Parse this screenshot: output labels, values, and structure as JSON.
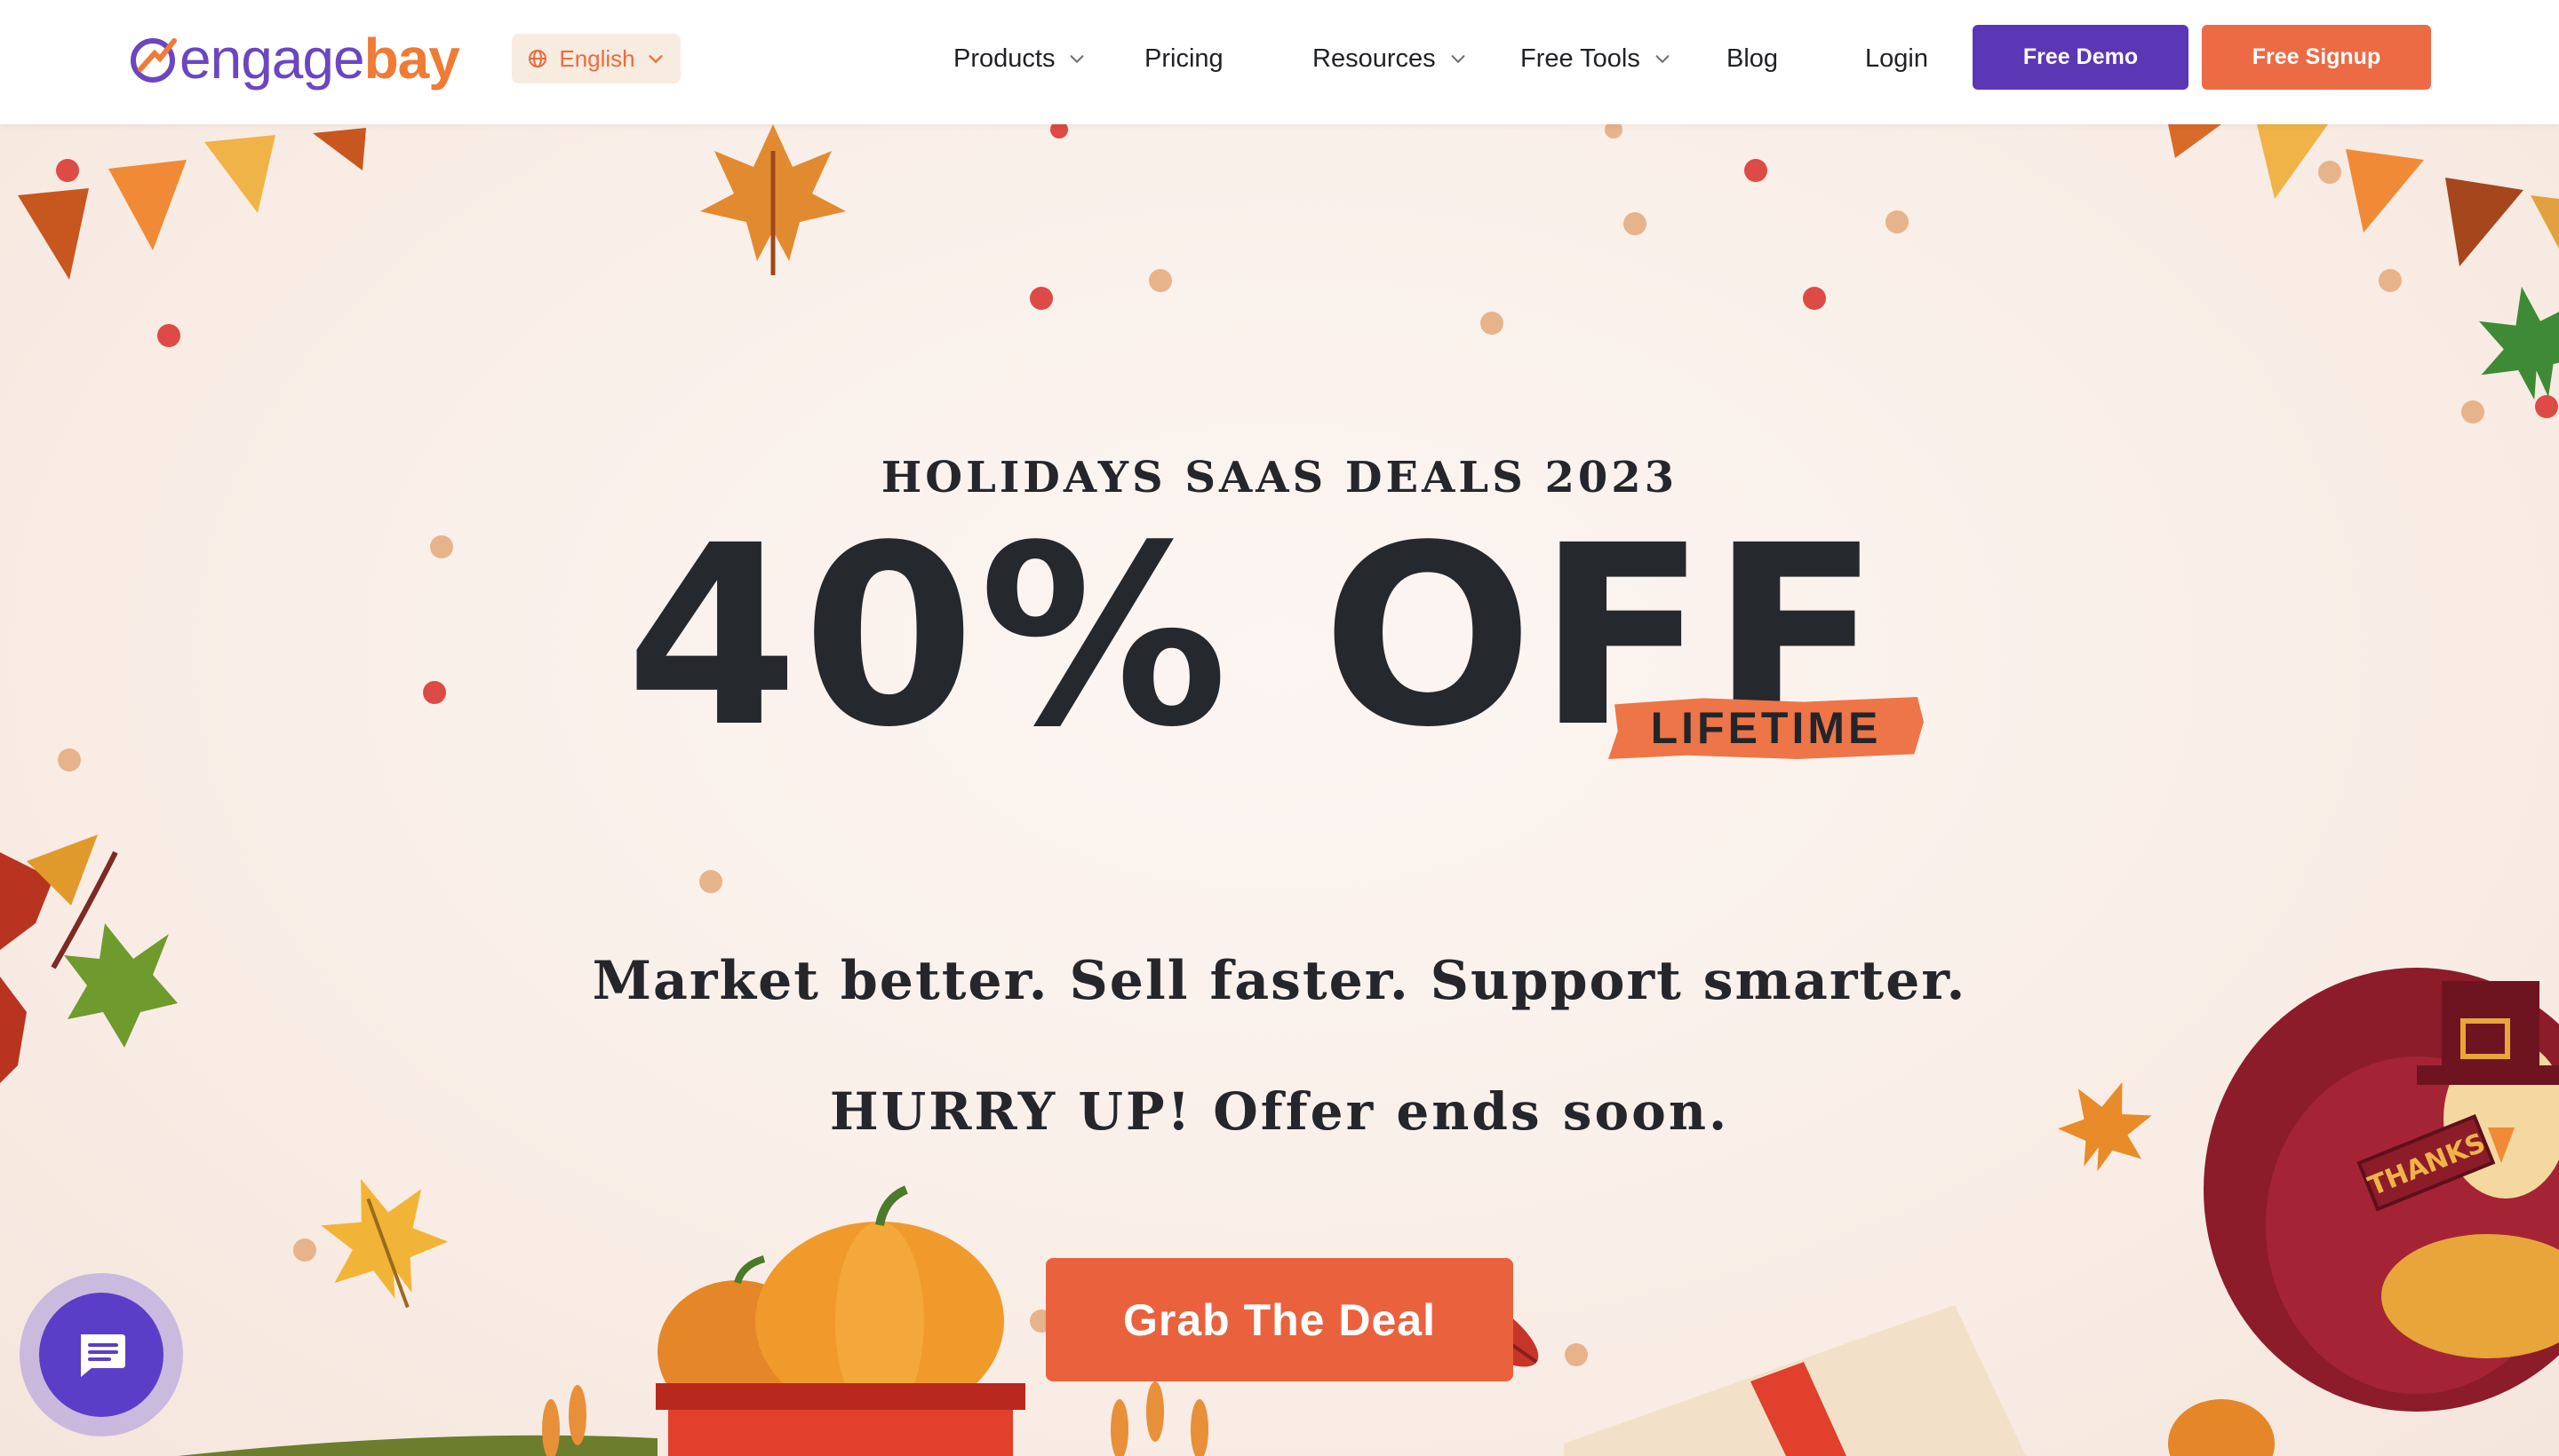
{
  "nav": {
    "logo_engage": "engage",
    "logo_bay": "bay",
    "language": "English",
    "items": [
      {
        "label": "Products",
        "dropdown": true
      },
      {
        "label": "Pricing",
        "dropdown": false
      },
      {
        "label": "Resources",
        "dropdown": true
      },
      {
        "label": "Free Tools",
        "dropdown": true
      },
      {
        "label": "Blog",
        "dropdown": false
      },
      {
        "label": "Login",
        "dropdown": false
      }
    ],
    "demo_label": "Free Demo",
    "signup_label": "Free Signup"
  },
  "hero": {
    "eyebrow": "HOLIDAYS SAAS DEALS 2023",
    "headline": "40% OFF",
    "badge": "LIFETIME",
    "tagline": "Market better. Sell faster. Support smarter.",
    "urgency": "HURRY UP! Offer ends soon.",
    "cta_label": "Grab The Deal",
    "decoration_sign": "THANKS"
  },
  "colors": {
    "brand_purple": "#5b36b5",
    "brand_orange": "#ec6a44",
    "hero_background": "#f9f0ea",
    "text_dark": "#24262b"
  },
  "icons": {
    "language": "globe-icon",
    "dropdown": "chevron-down-icon",
    "chat": "chat-bubble-icon"
  }
}
